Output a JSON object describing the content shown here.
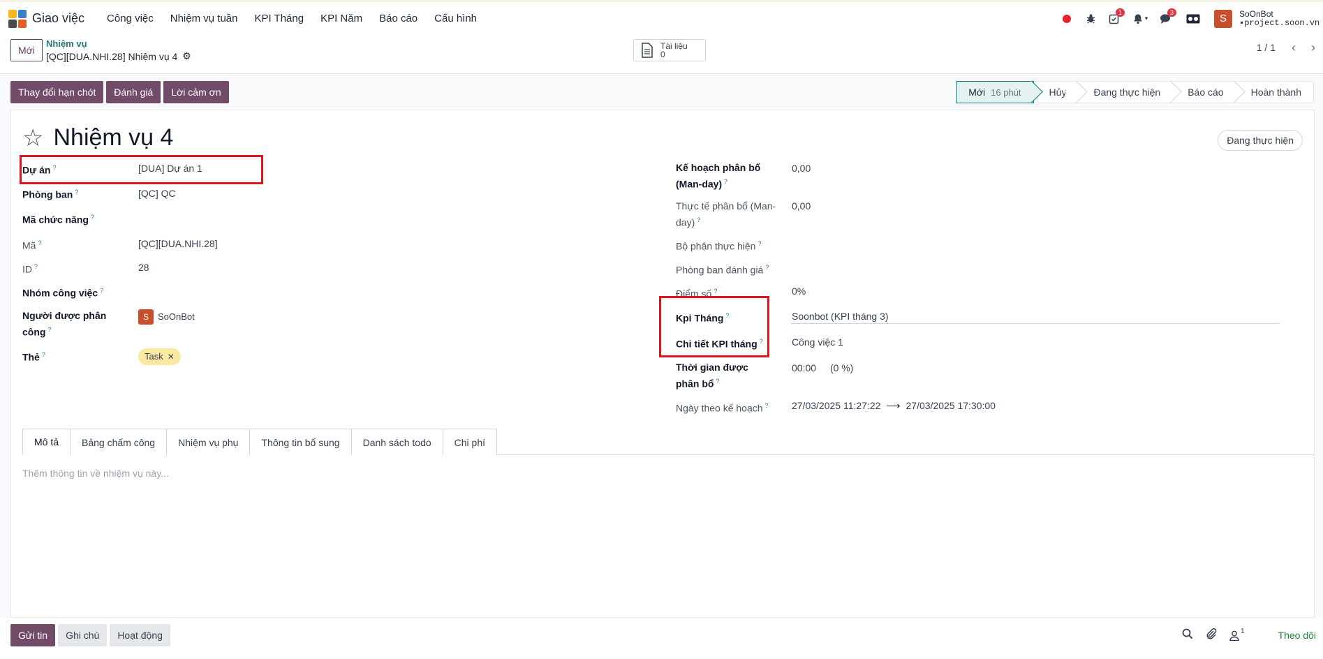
{
  "navbar": {
    "app_name": "Giao việc",
    "menu": [
      "Công việc",
      "Nhiệm vụ tuần",
      "KPI Tháng",
      "KPI Năm",
      "Báo cáo",
      "Cấu hình"
    ],
    "activity_badge": "1",
    "chat_badge": "3",
    "user_initial": "S",
    "user_name": "SoOnBot",
    "database": "project.soon.vn"
  },
  "control": {
    "new_label": "Mới",
    "breadcrumb_parent": "Nhiệm vụ",
    "breadcrumb_current": "[QC][DUA.NHI.28] Nhiệm vụ 4",
    "documents_label": "Tài liệu",
    "documents_count": "0",
    "pager_value": "1 / 1"
  },
  "actions": [
    "Thay đổi hạn chót",
    "Đánh giá",
    "Lời cảm ơn"
  ],
  "status": {
    "stages": [
      {
        "label": "Mới",
        "duration": "16 phút"
      },
      {
        "label": "Hủy"
      },
      {
        "label": "Đang thực hiện"
      },
      {
        "label": "Báo cáo"
      },
      {
        "label": "Hoàn thành"
      }
    ],
    "state_button": "Đang thực hiện"
  },
  "form": {
    "title": "Nhiệm vụ 4",
    "left": {
      "project_label": "Dự án",
      "project_value": "[DUA] Dự án 1",
      "department_label": "Phòng ban",
      "department_value": "[QC] QC",
      "function_code_label": "Mã chức năng",
      "code_label": "Mã",
      "code_value": "[QC][DUA.NHI.28]",
      "id_label": "ID",
      "id_value": "28",
      "work_group_label": "Nhóm công việc",
      "assignee_label": "Người được phân công",
      "assignee_initial": "S",
      "assignee_value": "SoOnBot",
      "tags_label": "Thẻ",
      "tag_value": "Task"
    },
    "right": {
      "plan_alloc_label": "Kế hoạch phân bổ (Man-day)",
      "plan_alloc_value": "0,00",
      "actual_alloc_label": "Thực tế phân bổ (Man-day)",
      "actual_alloc_value": "0,00",
      "exec_dept_label": "Bộ phận thực hiện",
      "eval_dept_label": "Phòng ban đánh giá",
      "score_label": "Điểm số",
      "score_value": "0%",
      "kpi_month_label": "Kpi Tháng",
      "kpi_month_value": "Soonbot (KPI tháng 3)",
      "kpi_detail_label": "Chi tiết KPI tháng",
      "kpi_detail_value": "Công việc 1",
      "alloc_time_label": "Thời gian được phân bổ",
      "alloc_time_value": "00:00",
      "alloc_time_pct": "(0 %)",
      "plan_date_label": "Ngày theo kế hoạch",
      "plan_date_start": "27/03/2025 11:27:22",
      "plan_date_end": "27/03/2025 17:30:00"
    },
    "tabs": [
      "Mô tả",
      "Bảng chấm công",
      "Nhiệm vụ phụ",
      "Thông tin bổ sung",
      "Danh sách todo",
      "Chi phí"
    ],
    "description_placeholder": "Thêm thông tin về nhiệm vụ này..."
  },
  "chatter": {
    "buttons": [
      "Gửi tin",
      "Ghi chú",
      "Hoạt động"
    ],
    "followers_count": "1",
    "follow_label": "Theo dõi"
  },
  "colors": {
    "primary": "#714b67",
    "teal": "#017e84",
    "highlight": "#e0141e"
  }
}
